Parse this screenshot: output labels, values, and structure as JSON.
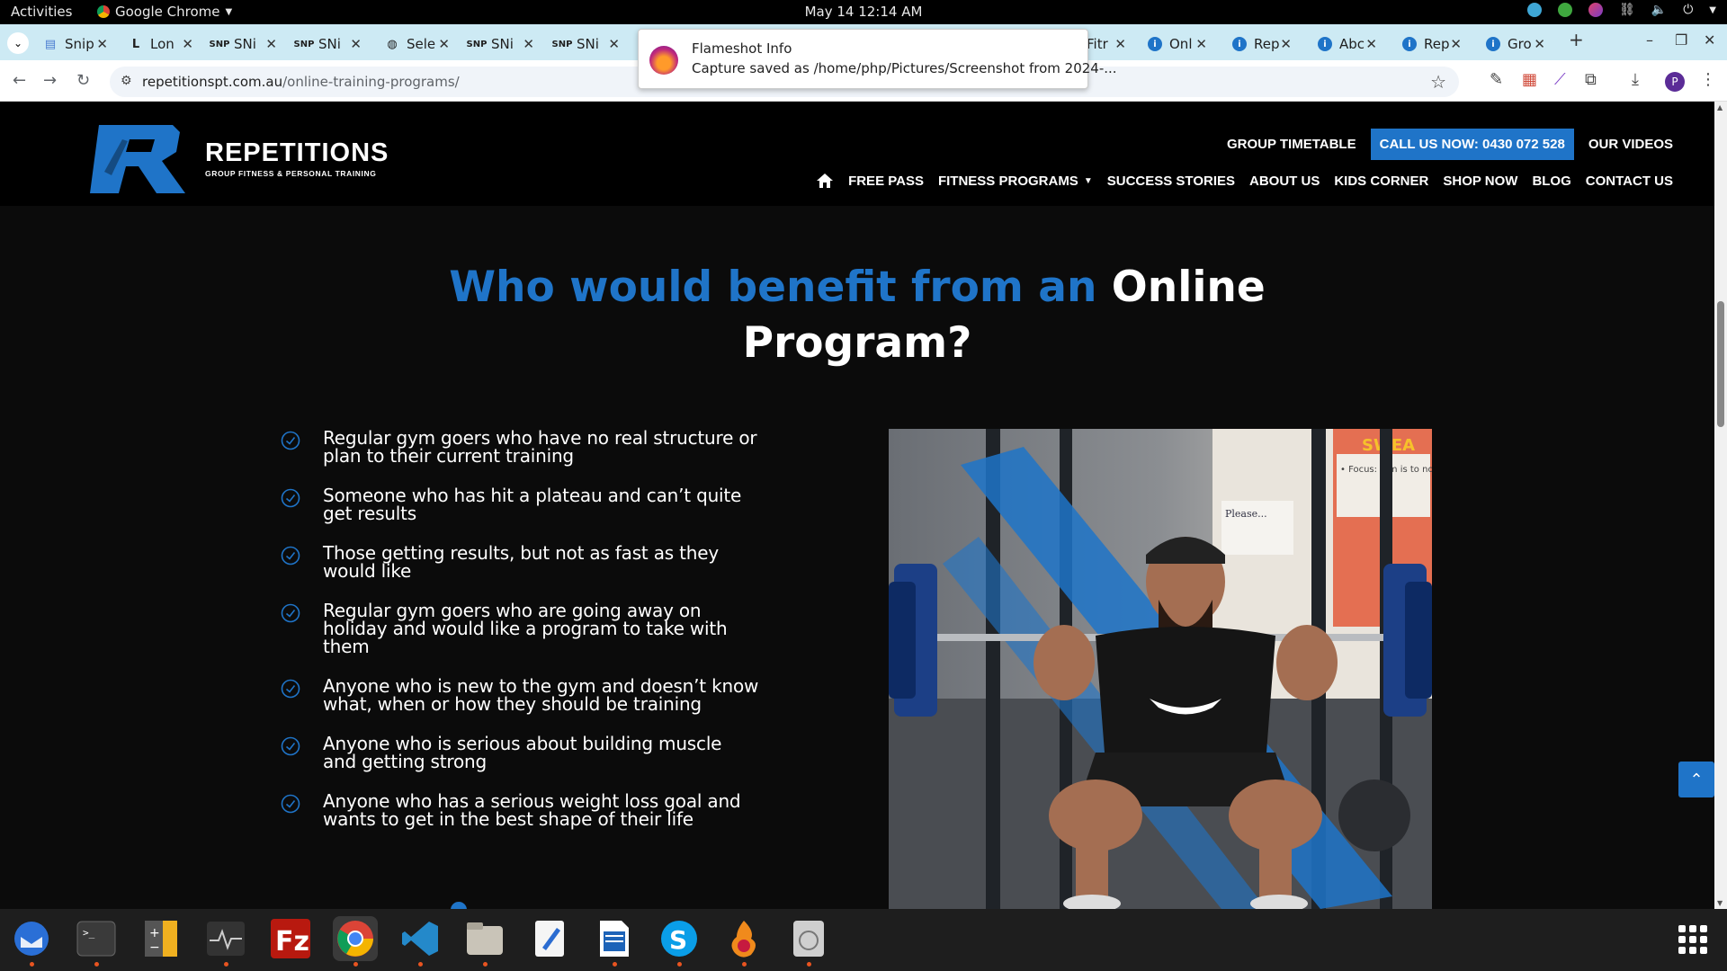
{
  "system_bar": {
    "activities": "Activities",
    "app_name": "Google Chrome",
    "clock": "May 14  12:14 AM"
  },
  "tabs": [
    {
      "label": "Snip",
      "icon": "doc-icon"
    },
    {
      "label": "Lon",
      "icon": "L"
    },
    {
      "label": "SNi",
      "icon": "SNP"
    },
    {
      "label": "SNi",
      "icon": "SNP"
    },
    {
      "label": "Sele",
      "icon": "globe-icon"
    },
    {
      "label": "SNi",
      "icon": "SNP"
    },
    {
      "label": "SNi",
      "icon": "SNP"
    },
    {
      "label": "Fitr",
      "icon": ""
    },
    {
      "label": "Onl",
      "icon": "site-icon"
    },
    {
      "label": "Rep",
      "icon": "site-icon"
    },
    {
      "label": "Abc",
      "icon": "site-icon"
    },
    {
      "label": "Rep",
      "icon": "site-icon"
    },
    {
      "label": "Gro",
      "icon": "site-icon"
    }
  ],
  "address": {
    "domain": "repetitionspt.com.au",
    "path": "/online-training-programs/"
  },
  "notification": {
    "title": "Flameshot Info",
    "body": "Capture saved as /home/php/Pictures/Screenshot from 2024-..."
  },
  "profile_initial": "P",
  "site": {
    "logo_name": "REPETITIONS",
    "logo_tagline": "GROUP FITNESS & PERSONAL TRAINING",
    "top_nav": {
      "timetable": "GROUP TIMETABLE",
      "call": "CALL US NOW: 0430 072 528",
      "videos": "OUR VIDEOS"
    },
    "main_nav": [
      "FREE PASS",
      "FITNESS PROGRAMS",
      "SUCCESS STORIES",
      "ABOUT US",
      "KIDS CORNER",
      "SHOP NOW",
      "BLOG",
      "CONTACT US"
    ],
    "headline_blue": "Who would benefit from an",
    "headline_white_1": "Online",
    "headline_white_2": "Program?",
    "benefits": [
      [
        "Regular gym goers who have no real structure or",
        "plan to their current training"
      ],
      [
        "Someone who has hit a plateau and can’t quite",
        "get results"
      ],
      [
        "Those getting results, but not as fast as they",
        "would like"
      ],
      [
        "Regular gym goers who are going away on",
        "holiday and would like a program to take with",
        "them"
      ],
      [
        "Anyone who is new to the gym and doesn’t know",
        "what, when or how they should be training"
      ],
      [
        "Anyone who is serious about building muscle",
        "and getting strong"
      ],
      [
        "Anyone who has a serious weight loss goal and",
        "wants to get in the best shape of their life"
      ]
    ],
    "photo_sign_1": "Please...",
    "photo_sign_2": "• Focus: Aim is to not any of the work per a lot of work to get make sure they pac themselves."
  },
  "colors": {
    "brand_blue": "#1f74c8",
    "page_bg": "#0b0b0b",
    "tabstrip_bg": "#cdeaf4"
  }
}
